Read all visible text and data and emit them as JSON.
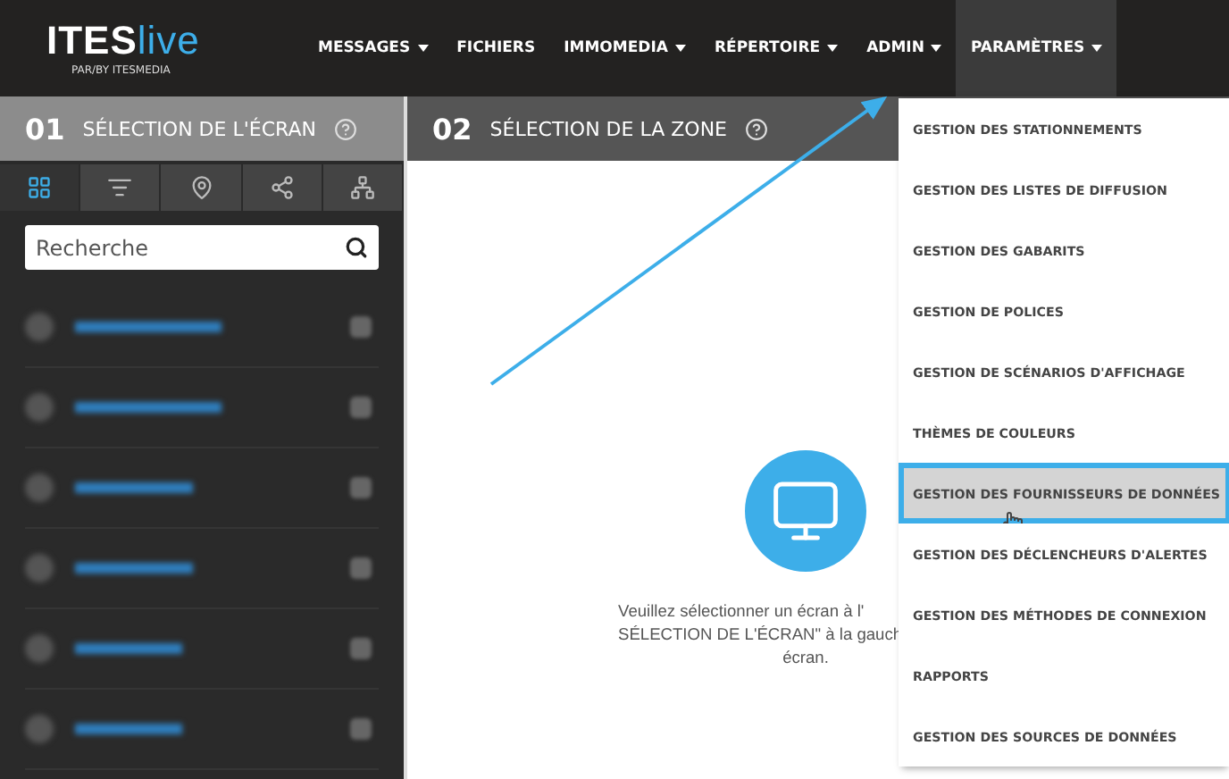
{
  "logo": {
    "brand": "ITES",
    "accent": "live",
    "tagline": "PAR/BY ITESMEDIA"
  },
  "nav": [
    {
      "label": "MESSAGES",
      "dropdown": true,
      "selected": false
    },
    {
      "label": "FICHIERS",
      "dropdown": false,
      "selected": false
    },
    {
      "label": "IMMOMEDIA",
      "dropdown": true,
      "selected": false
    },
    {
      "label": "RÉPERTOIRE",
      "dropdown": true,
      "selected": false
    },
    {
      "label": "ADMIN",
      "dropdown": true,
      "selected": false
    },
    {
      "label": "PARAMÈTRES",
      "dropdown": true,
      "selected": true
    }
  ],
  "left_panel": {
    "number": "01",
    "title": "SÉLECTION DE L'ÉCRAN",
    "tabs": [
      {
        "kind": "grid",
        "selected": true
      },
      {
        "kind": "filter",
        "selected": false
      },
      {
        "kind": "pin",
        "selected": false
      },
      {
        "kind": "share",
        "selected": false
      },
      {
        "kind": "network",
        "selected": false
      }
    ],
    "search": {
      "placeholder": "Recherche"
    }
  },
  "right_panel": {
    "number": "02",
    "title": "SÉLECTION DE LA ZONE",
    "message_lines": [
      "Veuillez sélectionner un écran à l'",
      "SÉLECTION DE L'ÉCRAN\" à la gauch",
      "écran."
    ]
  },
  "menu": [
    {
      "label": "GESTION DES STATIONNEMENTS",
      "selected": false
    },
    {
      "label": "GESTION DES LISTES DE DIFFUSION",
      "selected": false
    },
    {
      "label": "GESTION DES GABARITS",
      "selected": false
    },
    {
      "label": "GESTION DE POLICES",
      "selected": false
    },
    {
      "label": "GESTION DE SCÉNARIOS D'AFFICHAGE",
      "selected": false
    },
    {
      "label": "THÈMES DE COULEURS",
      "selected": false
    },
    {
      "label": "GESTION DES FOURNISSEURS DE DONNÉES",
      "selected": true
    },
    {
      "label": "GESTION DES DÉCLENCHEURS D'ALERTES",
      "selected": false
    },
    {
      "label": "GESTION DES MÉTHODES DE CONNEXION",
      "selected": false
    },
    {
      "label": "RAPPORTS",
      "selected": false
    },
    {
      "label": "GESTION DES SOURCES DE DONNÉES",
      "selected": false
    }
  ]
}
